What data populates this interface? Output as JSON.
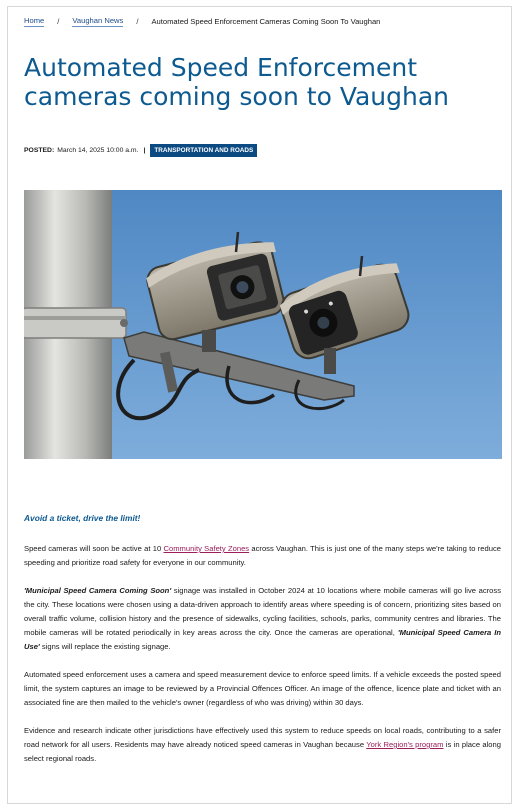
{
  "breadcrumb": {
    "home": "Home",
    "section": "Vaughan News",
    "current": "Automated Speed Enforcement Cameras Coming Soon To Vaughan",
    "separator": "/"
  },
  "article": {
    "title": "Automated Speed Enforcement cameras coming soon to Vaughan",
    "posted_label": "POSTED:",
    "posted_date": "March 14, 2025 10:00 a.m.",
    "posted_separator": "|",
    "category": "TRANSPORTATION AND ROADS",
    "subheading": "Avoid a ticket, drive the limit!",
    "p1": {
      "before": "Speed cameras will soon be active at 10 ",
      "link": "Community Safety Zones",
      "after": " across Vaughan. This is just one of the many steps we're taking to reduce speeding and prioritize road safety for everyone in our community."
    },
    "p2": {
      "em1": "'Municipal Speed Camera Coming Soon'",
      "middle": " signage was installed in October 2024 at 10 locations where mobile cameras will go live across the city. These locations were chosen using a data-driven approach to identify areas where speeding is of concern, prioritizing sites based on overall traffic volume, collision history and the presence of sidewalks, cycling facilities, schools, parks, community centres and libraries. The mobile cameras will be rotated periodically in key areas across the city. Once the cameras are operational, ",
      "em2": "'Municipal Speed Camera In Use'",
      "after": " signs will replace the existing signage."
    },
    "p3": "Automated speed enforcement uses a camera and speed measurement device to enforce speed limits. If a vehicle exceeds the posted speed limit, the system captures an image to be reviewed by a Provincial Offences Officer. An image of the offence, licence plate and ticket with an associated fine are then mailed to the vehicle's owner (regardless of who was driving) within 30 days.",
    "p4": {
      "before": "Evidence and research indicate other jurisdictions have effectively used this system to reduce speeds on local roads, contributing to a safer road network for all users. Residents may have already noticed speed cameras in Vaughan because ",
      "link": "York Region's program",
      "after": " is in place along select regional roads."
    }
  },
  "colors": {
    "title": "#0d5a91",
    "link": "#1f4e8c",
    "inline_link": "#9b1d5a",
    "tag_background": "#0c4a82",
    "sky": "#5b93cc"
  }
}
